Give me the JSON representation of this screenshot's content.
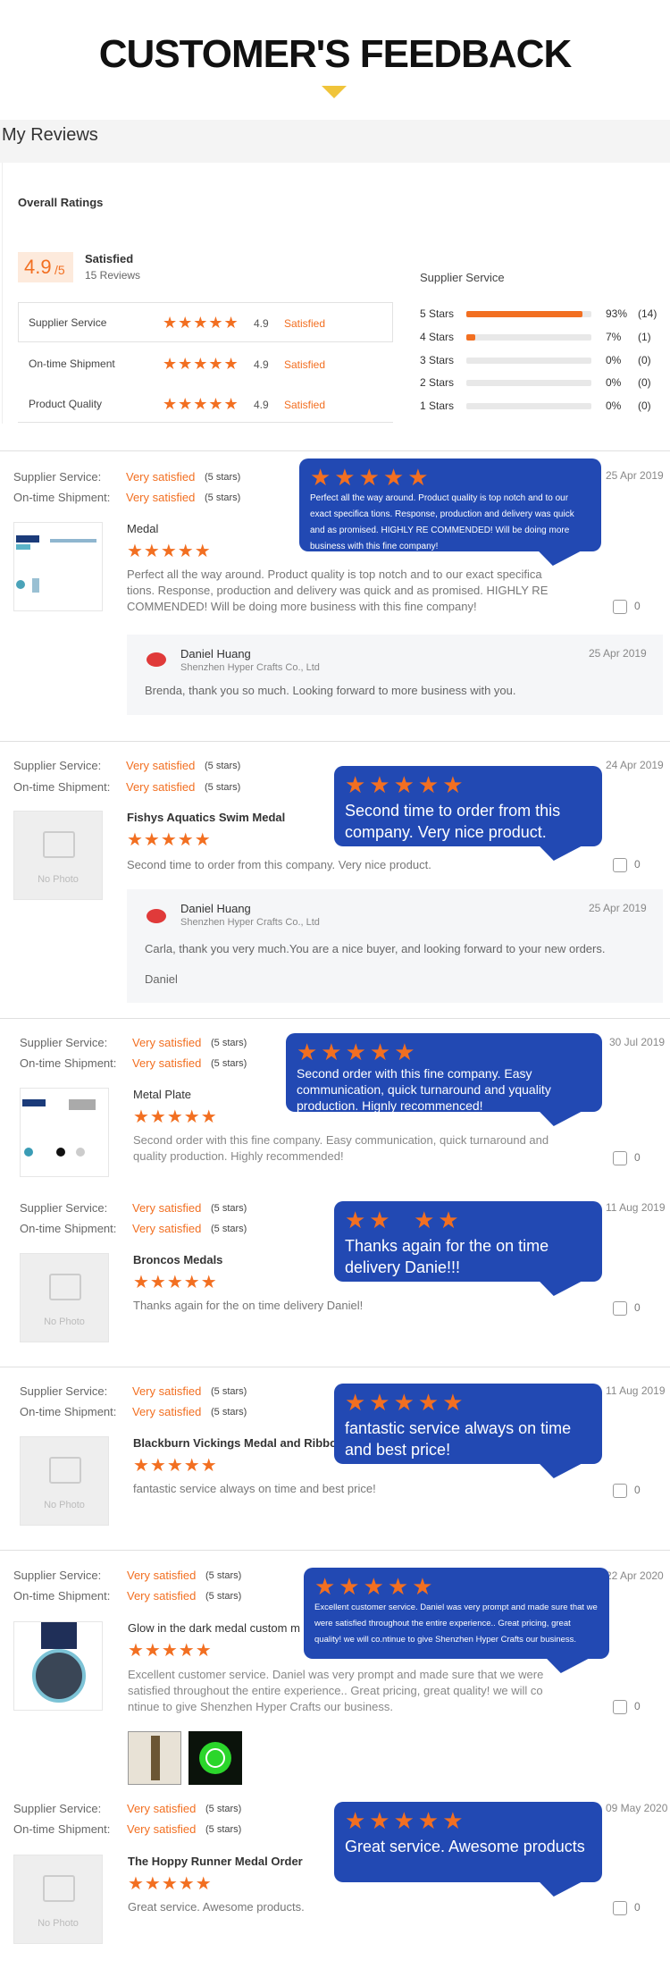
{
  "header": {
    "title": "CUSTOMER'S FEEDBACK"
  },
  "section_title": "My Reviews",
  "overall": {
    "heading": "Overall Ratings",
    "score": "4.9",
    "score_max": "/5",
    "score_label": "Satisfied",
    "reviews_count": "15 Reviews",
    "rows": [
      {
        "label": "Supplier Service",
        "stars": "★★★★★",
        "value": "4.9",
        "status": "Satisfied"
      },
      {
        "label": "On-time Shipment",
        "stars": "★★★★★",
        "value": "4.9",
        "status": "Satisfied"
      },
      {
        "label": "Product Quality",
        "stars": "★★★★★",
        "value": "4.9",
        "status": "Satisfied"
      }
    ]
  },
  "breakdown": {
    "title": "Supplier Service",
    "rows": [
      {
        "label": "5 Stars",
        "pct": "93%",
        "count": "(14)",
        "fill": 93
      },
      {
        "label": "4 Stars",
        "pct": "7%",
        "count": "(1)",
        "fill": 7
      },
      {
        "label": "3 Stars",
        "pct": "0%",
        "count": "(0)",
        "fill": 0
      },
      {
        "label": "2 Stars",
        "pct": "0%",
        "count": "(0)",
        "fill": 0
      },
      {
        "label": "1 Stars",
        "pct": "0%",
        "count": "(0)",
        "fill": 0
      }
    ]
  },
  "common": {
    "supplier_service_label": "Supplier Service:",
    "on_time_label": "On-time Shipment:",
    "very_satisfied": "Very satisfied",
    "five_stars": "(5 stars)",
    "stars": "★★★★★",
    "no_photo": "No Photo",
    "likes": "0",
    "replier_name": "Daniel Huang",
    "replier_company": "Shenzhen Hyper Crafts Co., Ltd"
  },
  "reviews": [
    {
      "date": "25 Apr 2019",
      "product": "Medal",
      "text": "Perfect all the way around.  Product quality is top notch and to our exact specifica tions.  Response, production and delivery was quick and as promised.  HIGHLY RE COMMENDED!  Will be doing more business with this fine company!",
      "bubble_stars": "★★★★★",
      "bubble": "Perfect all the way around. Product quality is top notch and to our exact specifica tions. Response, production and delivery was quick and as promised. HIGHLY RE COMMENDED! Will be doing more business with this fine company!",
      "reply_date": "25 Apr 2019",
      "reply_text": "Brenda, thank you so much. Looking forward to more business with you."
    },
    {
      "date": "24 Apr 2019",
      "product": "Fishys Aquatics Swim Medal",
      "text": "Second time to order from this company.  Very nice product.",
      "bubble_stars": "★★★★★",
      "bubble": "Second time to order from this company. Very nice product.",
      "reply_date": "25 Apr 2019",
      "reply_text": "Carla, thank you very much.You are a nice buyer, and looking forward to your new orders.",
      "reply_sign": "Daniel"
    },
    {
      "date": "30 Jul 2019",
      "product": "Metal Plate",
      "text": "Second order with this fine company.  Easy communication, quick turnaround and quality production.  Highly recommended!",
      "bubble_stars": "★★★★★",
      "bubble": "Second order with this fine company. Easy communication, quick turnaround and yquality production. Hignly recommenced!"
    },
    {
      "date": "11 Aug 2019",
      "product": "Broncos Medals",
      "text": "Thanks again for the on time delivery Daniel!",
      "bubble_stars": "★★  ★★",
      "bubble": "Thanks again for the on time delivery Danie!!!"
    },
    {
      "date": "11 Aug 2019",
      "product": "Blackburn Vickings Medal and Ribbon",
      "text": "fantastic service always on time and best price!",
      "bubble_stars": "★★★★★",
      "bubble": "fantastic service always on time and best price!"
    },
    {
      "date": "22 Apr 2020",
      "product": "Glow in the dark medal custom m",
      "text": "Excellent customer service. Daniel was very prompt and made sure that we were satisfied throughout the entire experience.. Great pricing, great quality! we will co ntinue to give Shenzhen Hyper Crafts our business.",
      "bubble_stars": "★★★★★",
      "bubble": "Excellent customer service. Daniel was very prompt and made sure that we were satisfied throughout the entire experience.. Great pricing, great quality! we will co.ntinue to give Shenzhen Hyper Crafts our business."
    },
    {
      "date": "09 May 2020",
      "product": "The Hoppy Runner Medal Order",
      "text": "Great service.  Awesome products.",
      "bubble_stars": "★★★★★",
      "bubble": "Great service. Awesome products"
    }
  ],
  "colors": {
    "accent": "#f26f21",
    "bubble": "#2249b3",
    "arrow": "#f0c43a"
  }
}
